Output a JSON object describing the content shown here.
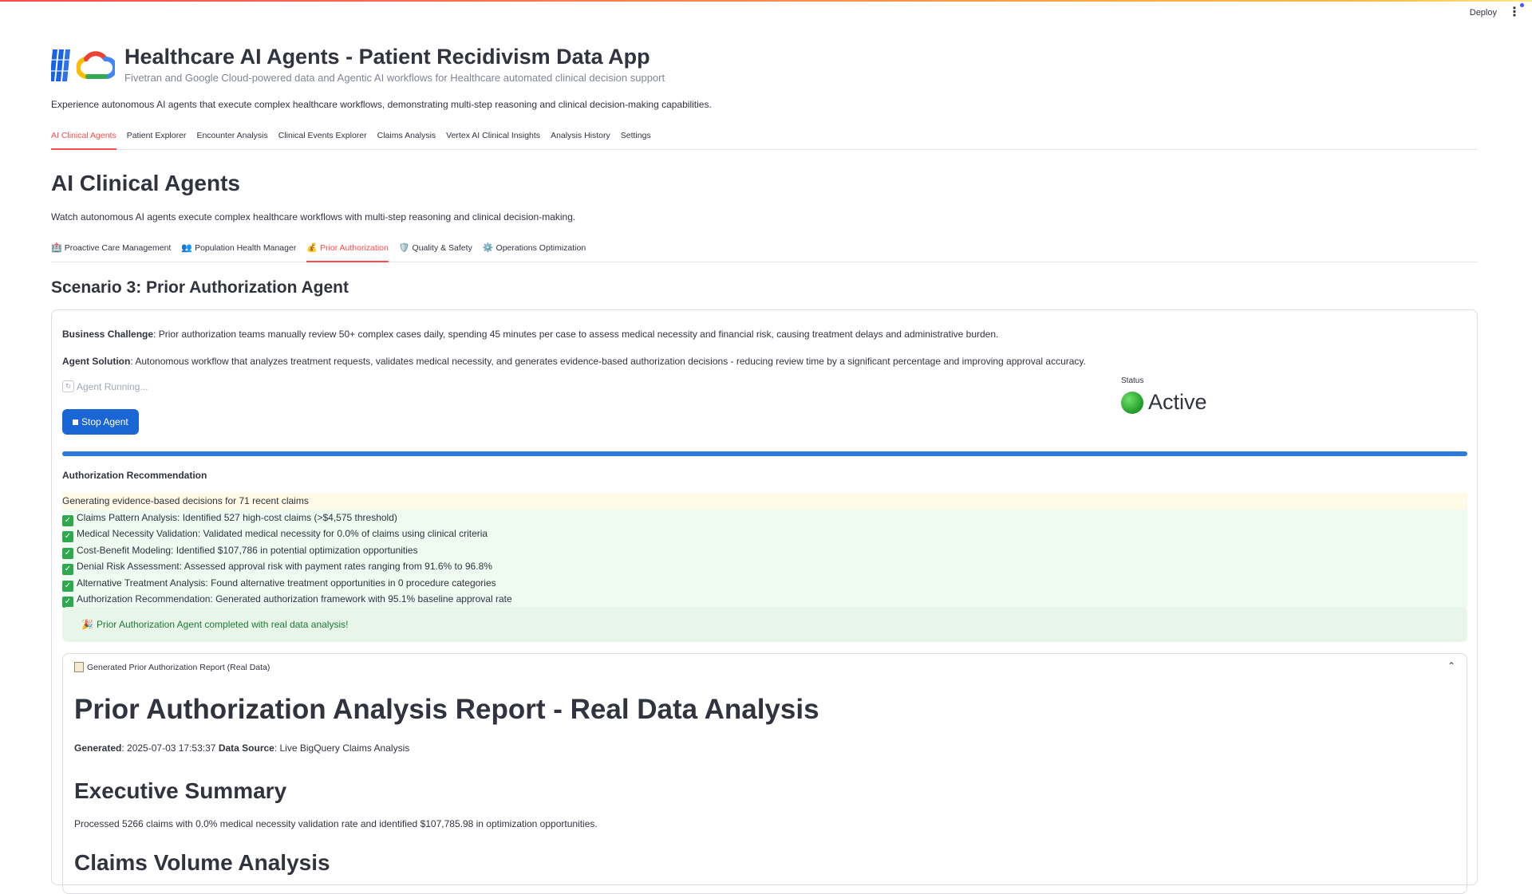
{
  "toolbar": {
    "deploy_label": "Deploy",
    "menu_glyph": "⋮"
  },
  "header": {
    "title": "Healthcare AI Agents - Patient Recidivism Data App",
    "subtitle": "Fivetran and Google Cloud-powered data and Agentic AI workflows for Healthcare automated clinical decision support",
    "intro": "Experience autonomous AI agents that execute complex healthcare workflows, demonstrating multi-step reasoning and clinical decision-making capabilities."
  },
  "main_tabs": [
    "AI Clinical Agents",
    "Patient Explorer",
    "Encounter Analysis",
    "Clinical Events Explorer",
    "Claims Analysis",
    "Vertex AI Clinical Insights",
    "Analysis History",
    "Settings"
  ],
  "page": {
    "title": "AI Clinical Agents",
    "description": "Watch autonomous AI agents execute complex healthcare workflows with multi-step reasoning and clinical decision-making."
  },
  "sub_tabs": [
    {
      "icon": "🏥",
      "label": "Proactive Care Management"
    },
    {
      "icon": "👥",
      "label": "Population Health Manager"
    },
    {
      "icon": "💰",
      "label": "Prior Authorization"
    },
    {
      "icon": "🛡️",
      "label": "Quality & Safety"
    },
    {
      "icon": "⚙️",
      "label": "Operations Optimization"
    }
  ],
  "scenario": {
    "title": "Scenario 3: Prior Authorization Agent",
    "challenge_label": "Business Challenge",
    "challenge_text": ": Prior authorization teams manually review 50+ complex cases daily, spending 45 minutes per case to assess medical necessity and financial risk, causing treatment delays and administrative burden.",
    "solution_label": "Agent Solution",
    "solution_text": ": Autonomous workflow that analyzes treatment requests, validates medical necessity, and generates evidence-based authorization decisions - reducing review time by a significant percentage and improving approval accuracy.",
    "running_label": "Agent Running...",
    "stop_label": "Stop Agent",
    "status_label": "Status",
    "status_value": "Active",
    "progress_fraction": 1.0,
    "recommendation_title": "Authorization Recommendation",
    "log_in_progress": "Generating evidence-based decisions for 71 recent claims",
    "log_steps": [
      "Claims Pattern Analysis: Identified 527 high-cost claims (>$4,575 threshold)",
      "Medical Necessity Validation: Validated medical necessity for 0.0% of claims using clinical criteria",
      "Cost-Benefit Modeling: Identified $107,786 in potential optimization opportunities",
      "Denial Risk Assessment: Assessed approval risk with payment rates ranging from 91.6% to 96.8%",
      "Alternative Treatment Analysis: Found alternative treatment opportunities in 0 procedure categories",
      "Authorization Recommendation: Generated authorization framework with 95.1% baseline approval rate"
    ],
    "success_message": "Prior Authorization Agent completed with real data analysis!"
  },
  "report": {
    "expander_label": "Generated Prior Authorization Report (Real Data)",
    "title": "Prior Authorization Analysis Report - Real Data Analysis",
    "generated_label": "Generated",
    "generated_value": ": 2025-07-03 17:53:37",
    "source_label": "Data Source",
    "source_value": ": Live BigQuery Claims Analysis",
    "exec_summary_title": "Executive Summary",
    "exec_summary_text": "Processed 5266 claims with 0.0% medical necessity validation rate and identified $107,785.98 in optimization opportunities.",
    "next_section_title": "Claims Volume Analysis"
  },
  "colors": {
    "accent": "#ff4b4b",
    "primary_button": "#1a66d4",
    "progress": "#2e7bd6",
    "success": "#1c7a32"
  }
}
